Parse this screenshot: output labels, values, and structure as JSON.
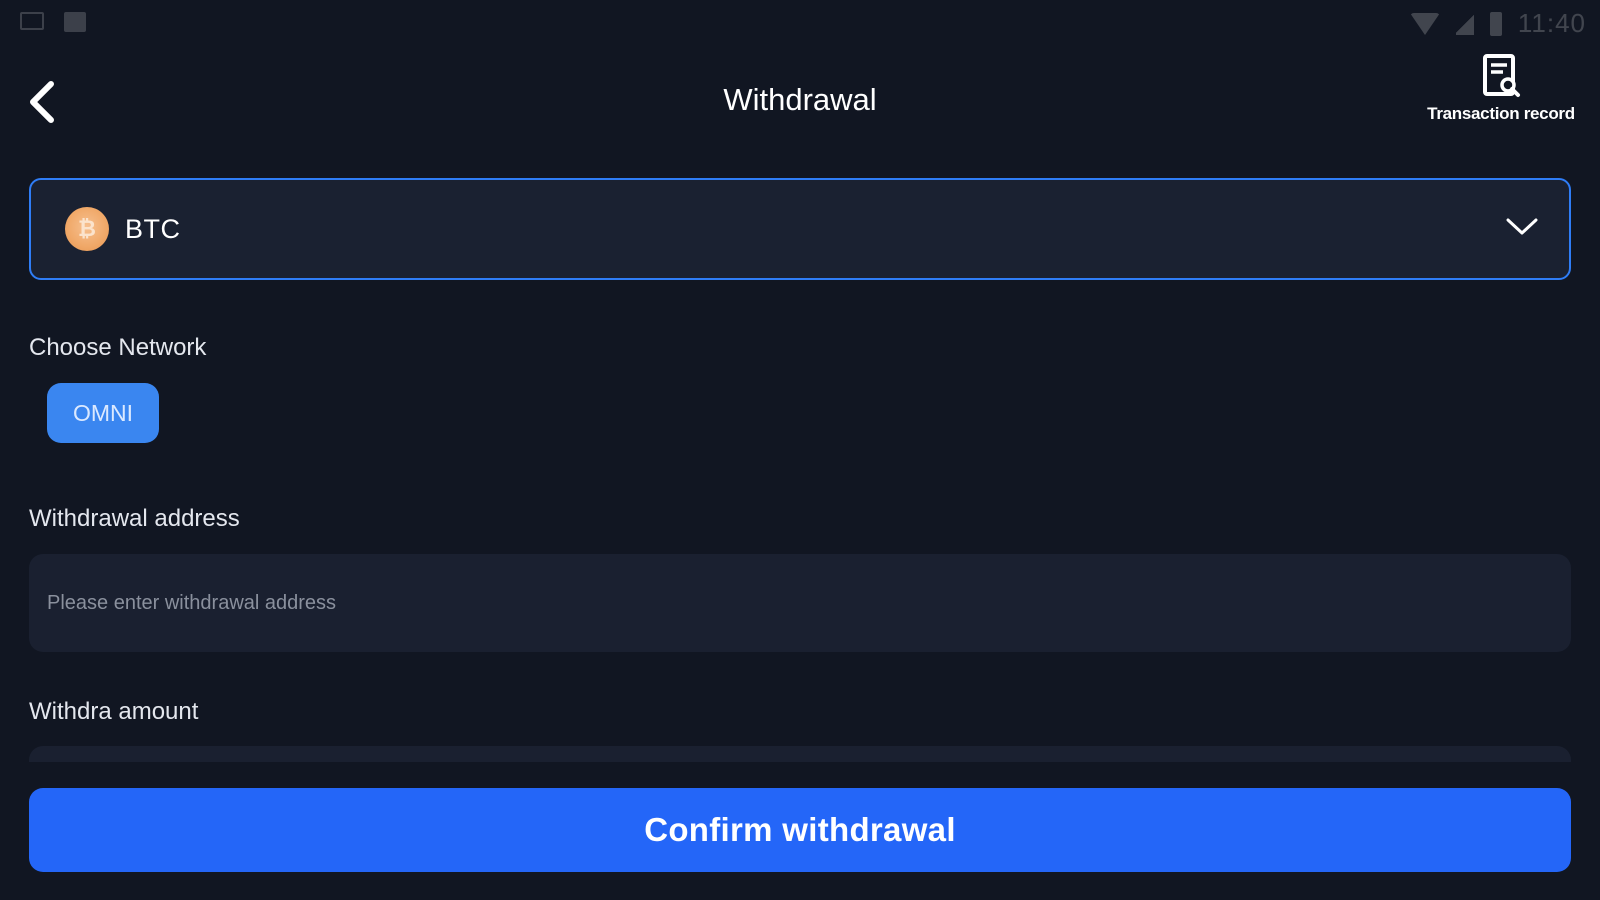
{
  "status_bar": {
    "time": "11:40",
    "left_icons": [
      "mail-icon",
      "image-icon"
    ],
    "right_icons": [
      "wifi-icon",
      "signal-icon",
      "battery-icon"
    ]
  },
  "header": {
    "title": "Withdrawal",
    "back_icon": "chevron-left-icon",
    "record_icon": "document-search-icon",
    "record_label": "Transaction record"
  },
  "coin_selector": {
    "symbol": "BTC",
    "coin_icon": "bitcoin-icon",
    "coin_icon_glyph": "₿",
    "dropdown_icon": "chevron-down-icon",
    "border_color": "#2f7df6"
  },
  "network": {
    "label": "Choose Network",
    "options": [
      "OMNI"
    ],
    "selected": "OMNI"
  },
  "address": {
    "label": "Withdrawal address",
    "placeholder": "Please enter withdrawal address",
    "value": ""
  },
  "amount": {
    "label": "Withdra amount"
  },
  "confirm_button": {
    "label": "Confirm withdrawal",
    "color": "#2466f8"
  },
  "colors": {
    "background": "#111622",
    "field_background": "#1a2030",
    "accent": "#2f7df6",
    "coin_orange": "#f0a868"
  }
}
